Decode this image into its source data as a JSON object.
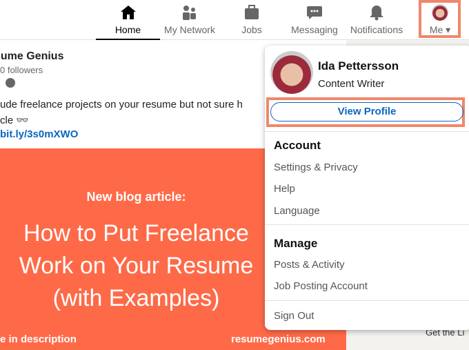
{
  "nav": {
    "items": [
      {
        "label": "Home",
        "icon": "home-icon",
        "active": true
      },
      {
        "label": "My Network",
        "icon": "network-icon"
      },
      {
        "label": "Jobs",
        "icon": "briefcase-icon"
      },
      {
        "label": "Messaging",
        "icon": "chat-icon"
      },
      {
        "label": "Notifications",
        "icon": "bell-icon"
      },
      {
        "label": "Me",
        "icon": "avatar"
      }
    ]
  },
  "post": {
    "author": "sume Genius",
    "followers": "0 followers",
    "text_line1": "ude freelance projects on your resume but not sure h",
    "text_line2": "cle 👓",
    "link": "bit.ly/3s0mXWO",
    "banner": {
      "kicker": "New blog article:",
      "title": "How to Put Freelance Work on Your Resume (with Examples)",
      "title_l1": "How to Put Freelance",
      "title_l2": "Work on Your Resume",
      "title_l3": "(with Examples)",
      "footer_left": "e in description",
      "footer_right": "resumegenius.com",
      "color": "#fe6a48"
    }
  },
  "sidebar": {
    "get_app": "Get the Li"
  },
  "menu": {
    "name": "Ida Pettersson",
    "title": "Content Writer",
    "view_profile": "View Profile",
    "account": {
      "heading": "Account",
      "items": [
        "Settings & Privacy",
        "Help",
        "Language"
      ]
    },
    "manage": {
      "heading": "Manage",
      "items": [
        "Posts & Activity",
        "Job Posting Account"
      ]
    },
    "sign_out": "Sign Out"
  },
  "highlight_color": "#f0876b"
}
